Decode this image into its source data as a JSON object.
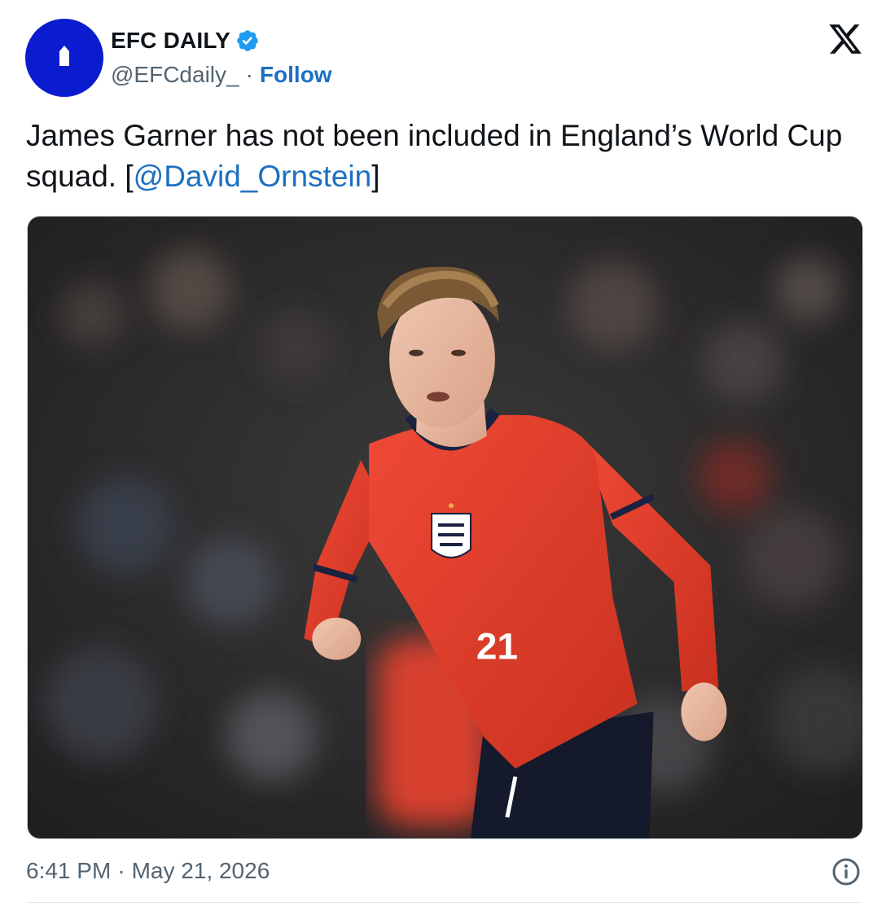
{
  "author": {
    "display_name": "EFC DAILY",
    "handle": "@EFCdaily_",
    "separator": "·",
    "follow_label": "Follow",
    "verified": true
  },
  "tweet": {
    "text_before": "James Garner has not been included in England’s World Cup squad. [",
    "mention": "@David_Ornstein",
    "text_after": "]"
  },
  "media": {
    "jersey_number": "21",
    "kit_color": "#e2402f"
  },
  "footer": {
    "time": "6:41 PM",
    "separator": "·",
    "date": "May 21, 2026"
  },
  "icons": {
    "platform": "x-logo-icon",
    "verified": "verified-badge-icon",
    "info": "info-icon"
  },
  "colors": {
    "link": "#1d6fbf",
    "avatar_bg": "#0b1ccf",
    "verified_badge": "#1d9bf0",
    "secondary_text": "#536471"
  }
}
